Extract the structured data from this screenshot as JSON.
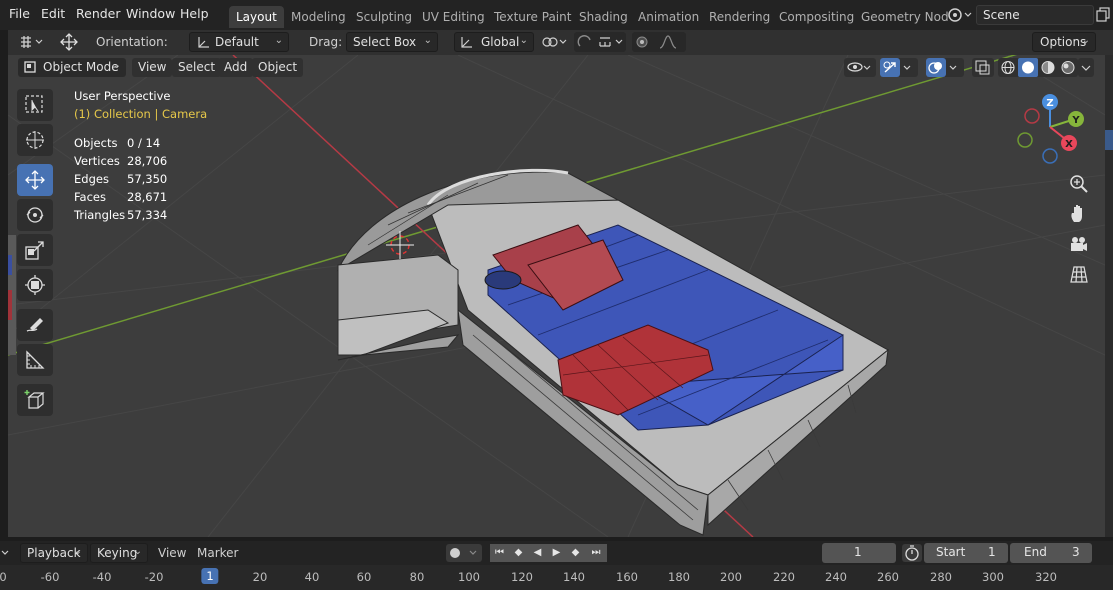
{
  "menu": {
    "items": [
      "File",
      "Edit",
      "Render",
      "Window",
      "Help"
    ]
  },
  "workspaces": {
    "tabs": [
      "Layout",
      "Modeling",
      "Sculpting",
      "UV Editing",
      "Texture Paint",
      "Shading",
      "Animation",
      "Rendering",
      "Compositing",
      "Geometry Nod"
    ],
    "active": "Layout"
  },
  "scene": {
    "name": "Scene"
  },
  "tool_header": {
    "orientation_label": "Orientation:",
    "orientation_value": "Default",
    "drag_label": "Drag:",
    "drag_value": "Select Box",
    "transform_orientation": "Global",
    "options_label": "Options"
  },
  "viewport_header": {
    "mode": "Object Mode",
    "menus": [
      "View",
      "Select",
      "Add",
      "Object"
    ]
  },
  "overlay": {
    "view_name": "User Perspective",
    "collection": "(1) Collection | Camera",
    "stats": [
      {
        "label": "Objects",
        "value": "0 / 14"
      },
      {
        "label": "Vertices",
        "value": "28,706"
      },
      {
        "label": "Edges",
        "value": "57,350"
      },
      {
        "label": "Faces",
        "value": "28,671"
      },
      {
        "label": "Triangles",
        "value": "57,334"
      }
    ]
  },
  "gizmo": {
    "z": "Z",
    "y": "Y",
    "x": "X"
  },
  "timeline": {
    "menus": [
      "Playback",
      "Keying",
      "View",
      "Marker"
    ],
    "current_frame": "1",
    "start_label": "Start",
    "start_value": "1",
    "end_label": "End",
    "end_value": "3",
    "ruler": [
      "0",
      "-60",
      "-40",
      "-20",
      "1",
      "20",
      "40",
      "60",
      "80",
      "100",
      "120",
      "140",
      "160",
      "180",
      "200",
      "220",
      "240",
      "260",
      "280",
      "300",
      "320"
    ]
  },
  "colors": {
    "accent": "#4772b3",
    "collection_text": "#e6c84a",
    "axis_x": "#e8475b",
    "axis_y": "#86b53b",
    "axis_z": "#4a8fe0"
  },
  "icons": [
    "editor-type-icon",
    "move-icon",
    "orientation-icon",
    "global-icon",
    "snap-icon",
    "proportional-icon",
    "visibility-icon",
    "gizmo-icon",
    "overlay-icon",
    "xray-icon",
    "wireframe-shading-icon",
    "solid-shading-icon",
    "material-shading-icon",
    "rendered-shading-icon",
    "zoom-icon",
    "pan-hand-icon",
    "camera-view-icon",
    "ortho-grid-icon",
    "select-box-tool-icon",
    "cursor-tool-icon",
    "move-tool-icon",
    "rotate-tool-icon",
    "scale-tool-icon",
    "transform-tool-icon",
    "annotate-tool-icon",
    "measure-tool-icon",
    "add-cube-tool-icon"
  ]
}
